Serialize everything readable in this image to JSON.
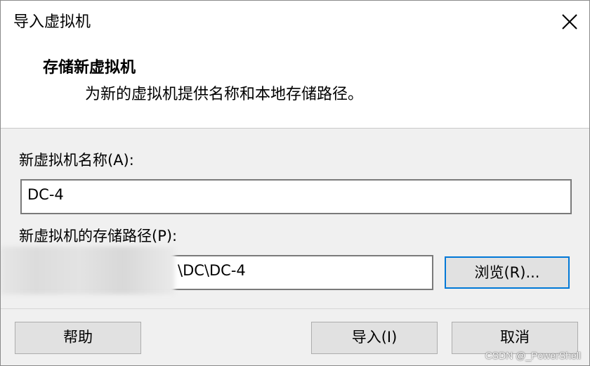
{
  "window": {
    "title": "导入虚拟机",
    "close_icon": "close-icon"
  },
  "header": {
    "title": "存储新虚拟机",
    "description": "为新的虚拟机提供名称和本地存储路径。"
  },
  "form": {
    "name_label": "新虚拟机名称(A):",
    "name_value": "DC-4",
    "path_label": "新虚拟机的存储路径(P):",
    "path_value": "\\DC\\DC-4",
    "browse_label": "浏览(R)..."
  },
  "footer": {
    "help_label": "帮助",
    "import_label": "导入(I)",
    "cancel_label": "取消"
  },
  "watermark": "CSDN @_PowerShell",
  "colors": {
    "accent": "#0078d7",
    "panel": "#f0f0f0",
    "button": "#e1e1e1"
  }
}
